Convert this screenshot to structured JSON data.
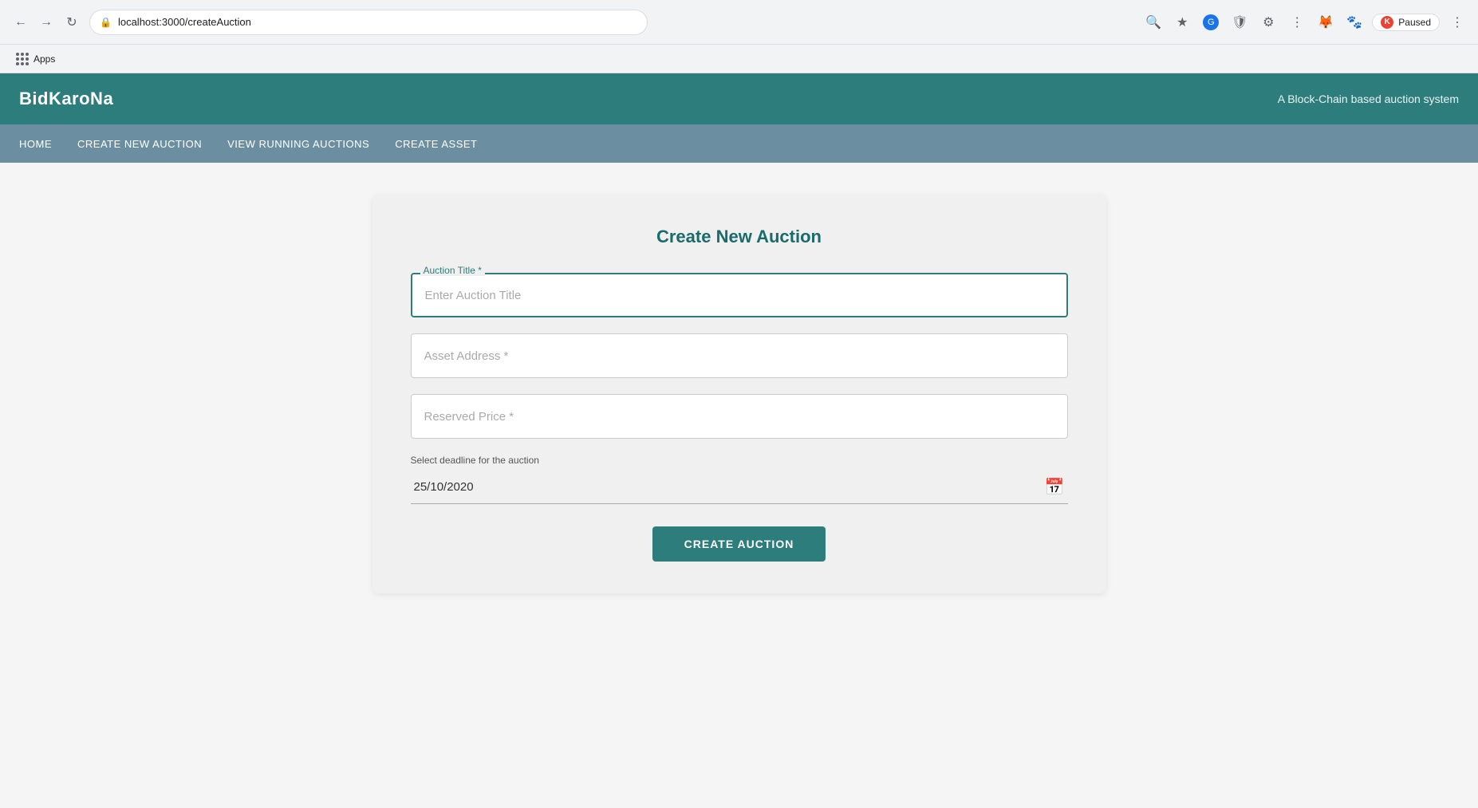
{
  "browser": {
    "url": "localhost:3000/createAuction",
    "paused_label": "Paused",
    "paused_key": "K"
  },
  "bookmarks": {
    "apps_label": "Apps"
  },
  "header": {
    "title": "BidKaroNa",
    "subtitle": "A Block-Chain based auction system"
  },
  "nav": {
    "items": [
      {
        "label": "HOME",
        "href": "/"
      },
      {
        "label": "CREATE NEW AUCTION",
        "href": "/createAuction"
      },
      {
        "label": "VIEW RUNNING AUCTIONS",
        "href": "/auctions"
      },
      {
        "label": "CREATE ASSET",
        "href": "/createAsset"
      }
    ]
  },
  "form": {
    "title": "Create New Auction",
    "auction_title_label": "Auction Title *",
    "auction_title_placeholder": "Enter Auction Title",
    "asset_address_placeholder": "Asset Address *",
    "reserved_price_placeholder": "Reserved Price *",
    "date_label": "Select deadline for the auction",
    "date_value": "25/10/2020",
    "submit_button": "CREATE AUCTION"
  }
}
